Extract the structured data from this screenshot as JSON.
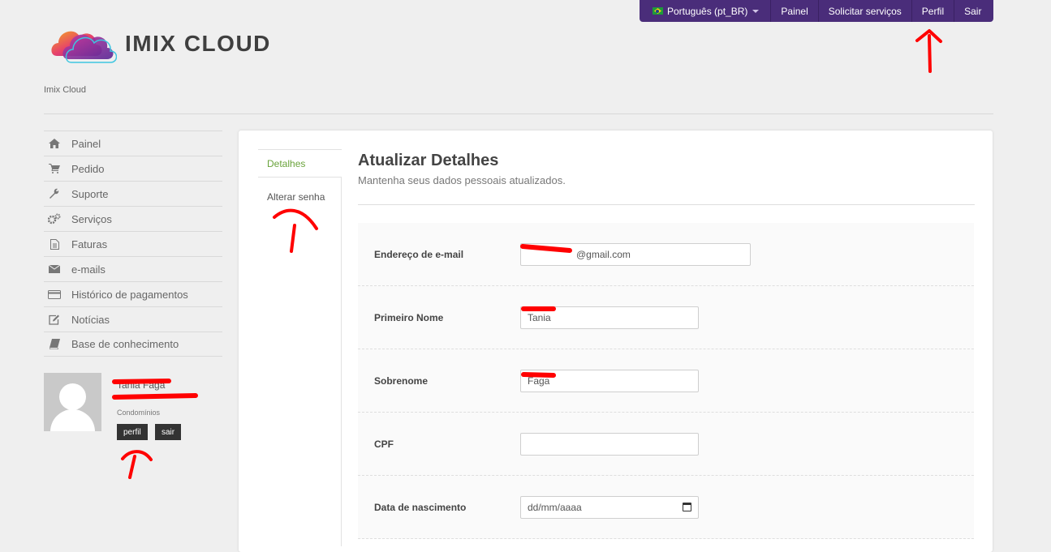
{
  "topbar": {
    "language": "Português (pt_BR)",
    "items": [
      "Painel",
      "Solicitar serviços",
      "Perfil",
      "Sair"
    ]
  },
  "logo": {
    "text": "IMIX CLOUD"
  },
  "tagline": "Imix Cloud",
  "sidebar": {
    "items": [
      {
        "label": "Painel",
        "icon": "home-icon"
      },
      {
        "label": "Pedido",
        "icon": "cart-icon"
      },
      {
        "label": "Suporte",
        "icon": "wrench-icon"
      },
      {
        "label": "Serviços",
        "icon": "gears-icon"
      },
      {
        "label": "Faturas",
        "icon": "document-icon"
      },
      {
        "label": "e-mails",
        "icon": "envelope-icon"
      },
      {
        "label": "Histórico de pagamentos",
        "icon": "credit-card-icon"
      },
      {
        "label": "Notícias",
        "icon": "edit-icon"
      },
      {
        "label": "Base de conhecimento",
        "icon": "book-icon"
      }
    ]
  },
  "user": {
    "name": "Tania Faga",
    "email": "",
    "company": "Condomínios",
    "profile_button": "perfil",
    "logout_button": "sair"
  },
  "tabs": [
    "Detalhes",
    "Alterar senha"
  ],
  "main": {
    "title": "Atualizar Detalhes",
    "subtitle": "Mantenha seus dados pessoais atualizados."
  },
  "form": {
    "email_label": "Endereço de e-mail",
    "email_value": "@gmail.com",
    "first_name_label": "Primeiro Nome",
    "first_name_value": "Tania",
    "last_name_label": "Sobrenome",
    "last_name_value": "Faga",
    "cpf_label": "CPF",
    "cpf_value": "",
    "birth_label": "Data de nascimento",
    "birth_placeholder": "dd/mm/aaaa"
  },
  "colors": {
    "topbar": "#4a2d7a",
    "active_tab": "#6aa33b",
    "annotation": "#ff0000"
  }
}
